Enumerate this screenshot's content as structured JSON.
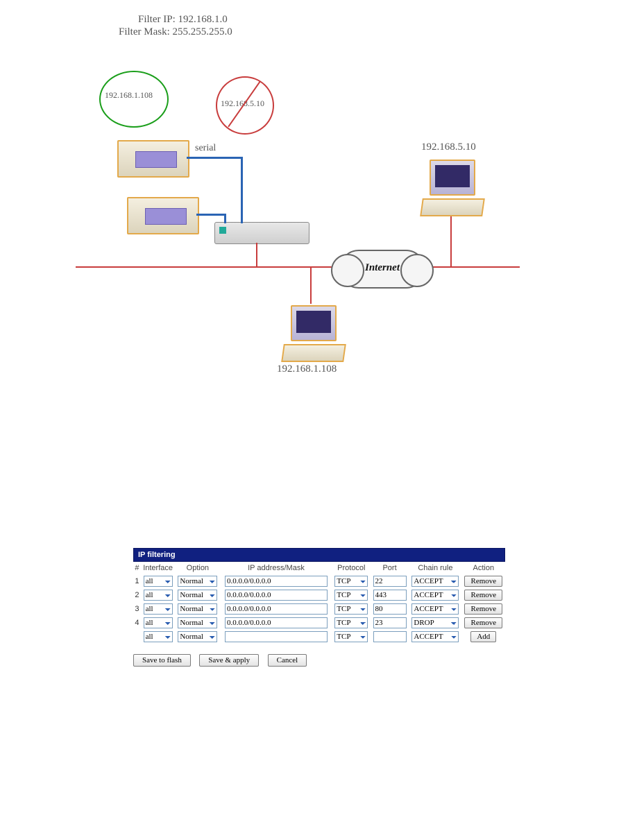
{
  "header": {
    "filter_ip_label": "Filter IP:",
    "filter_ip_value": "192.168.1.0",
    "filter_mask_label": "Filter Mask:",
    "filter_mask_value": "255.255.255.0"
  },
  "diagram": {
    "allowed_ip": "192.168.1.108",
    "blocked_ip": "192.168.5.10",
    "serial_label": "serial",
    "internet_label": "Internet",
    "pc_right_ip": "192.168.5.10",
    "pc_bottom_ip": "192.168.1.108"
  },
  "panel": {
    "title": "IP filtering",
    "headers": {
      "num": "#",
      "iface": "Interface",
      "option": "Option",
      "ipmask": "IP address/Mask",
      "proto": "Protocol",
      "port": "Port",
      "chain": "Chain rule",
      "action": "Action"
    },
    "rows": [
      {
        "n": "1",
        "iface": "all",
        "option": "Normal",
        "ipmask": "0.0.0.0/0.0.0.0",
        "proto": "TCP",
        "port": "22",
        "chain": "ACCEPT",
        "action": "Remove"
      },
      {
        "n": "2",
        "iface": "all",
        "option": "Normal",
        "ipmask": "0.0.0.0/0.0.0.0",
        "proto": "TCP",
        "port": "443",
        "chain": "ACCEPT",
        "action": "Remove"
      },
      {
        "n": "3",
        "iface": "all",
        "option": "Normal",
        "ipmask": "0.0.0.0/0.0.0.0",
        "proto": "TCP",
        "port": "80",
        "chain": "ACCEPT",
        "action": "Remove"
      },
      {
        "n": "4",
        "iface": "all",
        "option": "Normal",
        "ipmask": "0.0.0.0/0.0.0.0",
        "proto": "TCP",
        "port": "23",
        "chain": "DROP",
        "action": "Remove"
      }
    ],
    "new_row": {
      "iface": "all",
      "option": "Normal",
      "ipmask": "",
      "proto": "TCP",
      "port": "",
      "chain": "ACCEPT",
      "action": "Add"
    }
  },
  "buttons": {
    "save_flash": "Save to flash",
    "save_apply": "Save & apply",
    "cancel": "Cancel"
  }
}
